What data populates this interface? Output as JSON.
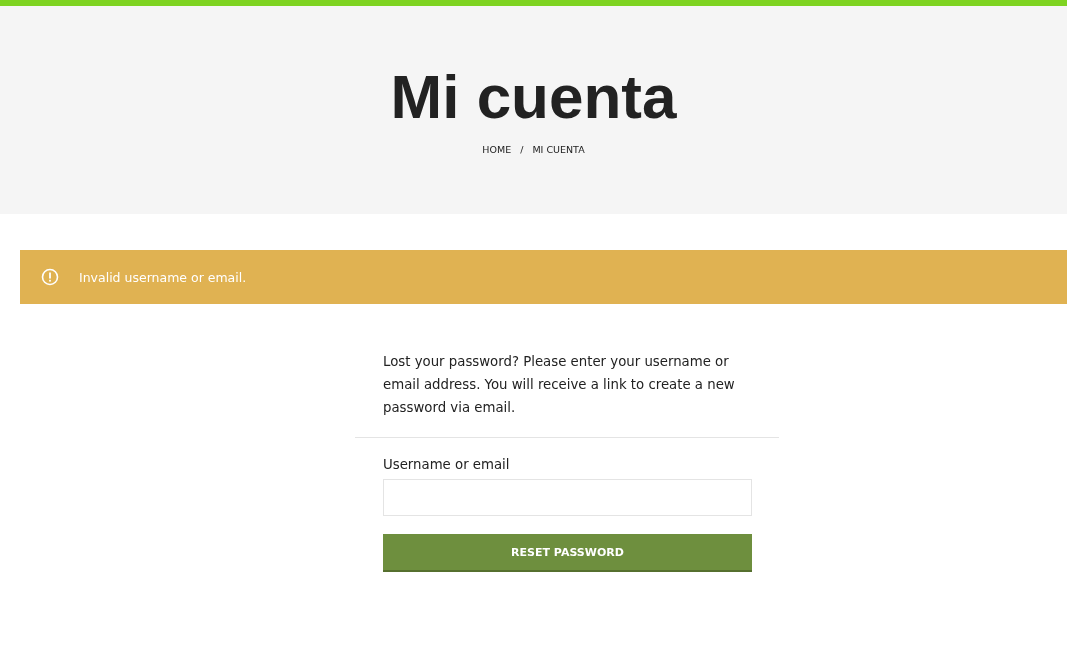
{
  "page_title": "Mi cuenta",
  "breadcrumb": {
    "items": [
      "HOME",
      "MI CUENTA"
    ],
    "separator": "/"
  },
  "notice": {
    "kind": "error",
    "message": "Invalid username or email."
  },
  "form": {
    "intro": "Lost your password? Please enter your username or email address. You will receive a link to create a new password via email.",
    "field_label": "Username or email",
    "button": "RESET PASSWORD"
  }
}
